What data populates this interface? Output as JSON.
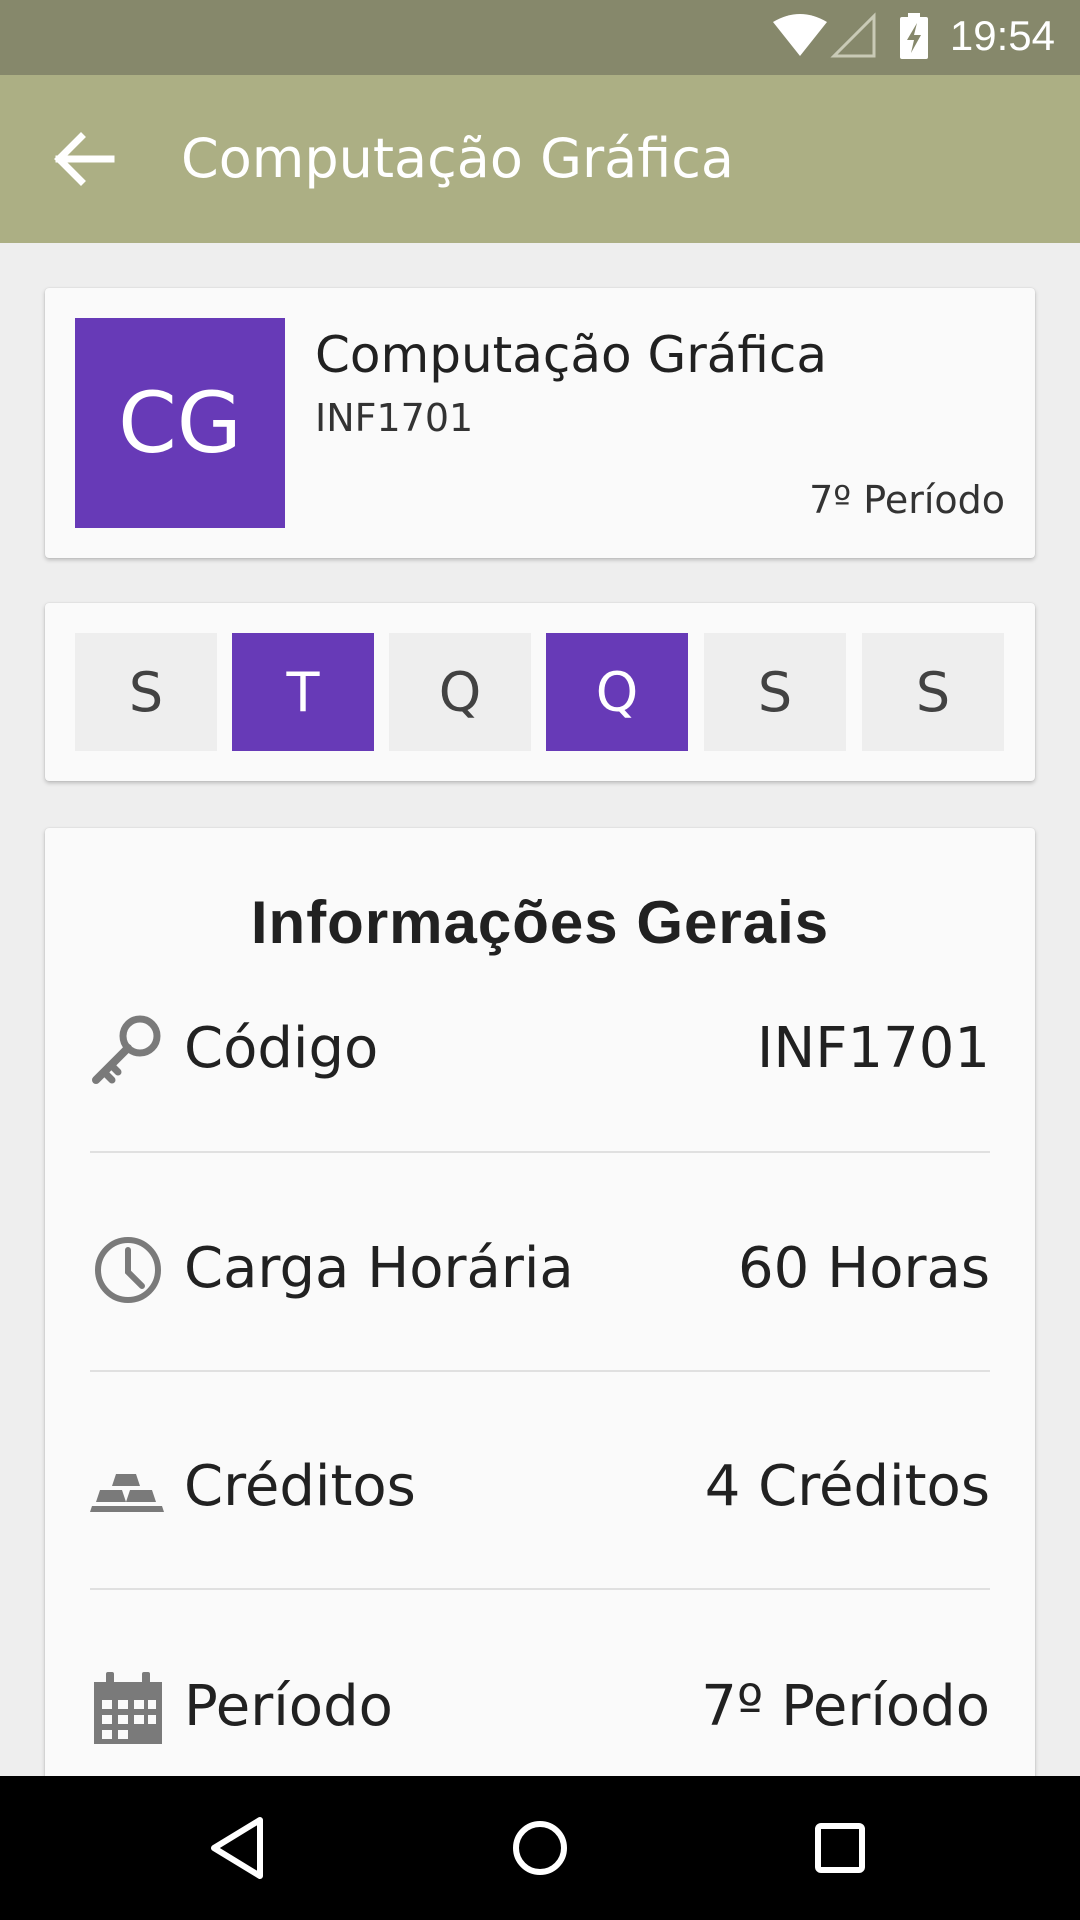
{
  "status_bar": {
    "time": "19:54",
    "icons": [
      "wifi-icon",
      "signal-icon",
      "battery-charging-icon"
    ]
  },
  "app_bar": {
    "back_icon": "arrow-back-icon",
    "title": "Computação Gráfica"
  },
  "course": {
    "initials": "CG",
    "name": "Computação Gráfica",
    "code": "INF1701",
    "period": "7º Período",
    "avatar_color": "#673ab7"
  },
  "days": [
    {
      "letter": "S",
      "active": false
    },
    {
      "letter": "T",
      "active": true
    },
    {
      "letter": "Q",
      "active": false
    },
    {
      "letter": "Q",
      "active": true
    },
    {
      "letter": "S",
      "active": false
    },
    {
      "letter": "S",
      "active": false
    }
  ],
  "info": {
    "title": "Informações Gerais",
    "rows": [
      {
        "icon": "key-icon",
        "label": "Código",
        "value": "INF1701"
      },
      {
        "icon": "clock-icon",
        "label": "Carga Horária",
        "value": "60 Horas"
      },
      {
        "icon": "gold-bars-icon",
        "label": "Créditos",
        "value": "4 Créditos"
      },
      {
        "icon": "calendar-icon",
        "label": "Período",
        "value": "7º Período"
      }
    ]
  },
  "nav_bar": {
    "buttons": [
      "back-triangle-icon",
      "home-circle-icon",
      "recents-square-icon"
    ]
  },
  "colors": {
    "status_bar": "#86886b",
    "app_bar": "#acaf84",
    "accent": "#673ab7",
    "icon_gray": "#7a7a7a"
  }
}
